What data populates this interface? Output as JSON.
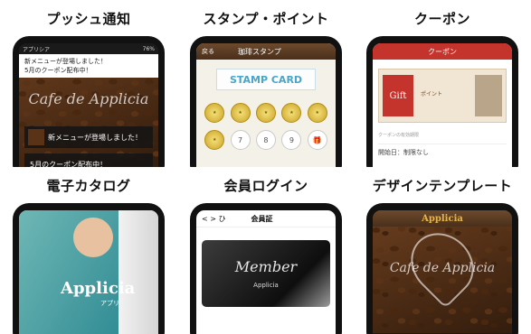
{
  "captions": [
    "プッシュ通知",
    "スタンプ・ポイント",
    "クーポン",
    "電子カタログ",
    "会員ログイン",
    "デザインテンプレート"
  ],
  "push": {
    "status_left": "アプリシア",
    "status_right": "76%",
    "notif_lines": [
      "新メニューが登場しました！",
      "5月のクーポン配布中！"
    ],
    "brand": "Cafe de Applicia",
    "msg1": "新メニューが登場しました！",
    "msg2": "5月のクーポン配布中！"
  },
  "stamp": {
    "back": "戻る",
    "title": "珈琲スタンプ",
    "card_label": "STAMP CARD",
    "numbers": [
      "7",
      "8",
      "9"
    ]
  },
  "coupon": {
    "title": "クーポン",
    "gift": "Gift",
    "ticket_text": "ポイント",
    "expiry_label": "クーポンの有効期限",
    "expiry_value": "開始日：制限なし"
  },
  "catalog": {
    "brand": "Applicia",
    "brand_sub": "アプリ"
  },
  "member": {
    "nav": "< > ひ",
    "title": "会員証",
    "card_title": "Member",
    "card_brand": "Applicia"
  },
  "template": {
    "brand": "Applicia",
    "script": "Cafe de Applicia"
  },
  "colors": {
    "accent_gold": "#c9a227",
    "coupon_red": "#c4332c"
  }
}
